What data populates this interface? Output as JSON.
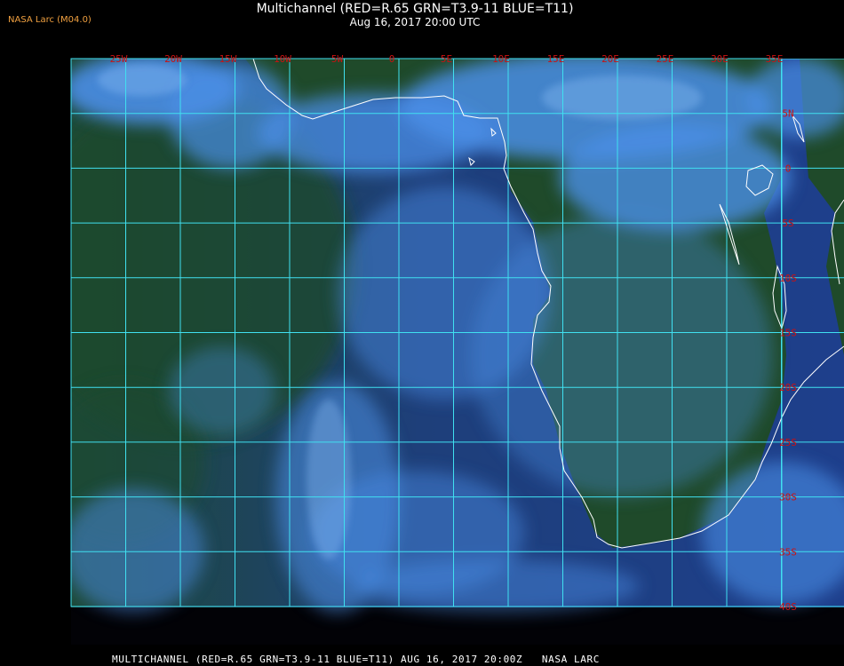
{
  "header": {
    "brand": "NASA Larc (M04.0)",
    "title": "Multichannel (RED=R.65 GRN=T3.9-11 BLUE=T11)",
    "subtitle": "Aug 16, 2017 20:00 UTC"
  },
  "footer": {
    "caption": "MULTICHANNEL (RED=R.65 GRN=T3.9-11 BLUE=T11) AUG 16, 2017 20:00Z   NASA LARC"
  },
  "map": {
    "longitude_labels": [
      "25W",
      "20W",
      "15W",
      "10W",
      "5W",
      "0",
      "5E",
      "10E",
      "15E",
      "20E",
      "25E",
      "30E",
      "35E"
    ],
    "latitude_labels": [
      "5N",
      "0",
      "5S",
      "10S",
      "15S",
      "20S",
      "25S",
      "30S",
      "35S",
      "40S"
    ],
    "colors": {
      "grid": "#40e0f0",
      "label": "#cc1111",
      "coast": "#ffffff",
      "ocean": "#1e3f8c",
      "land": "#1f4a2a",
      "cloud": "#4a90e8"
    }
  }
}
